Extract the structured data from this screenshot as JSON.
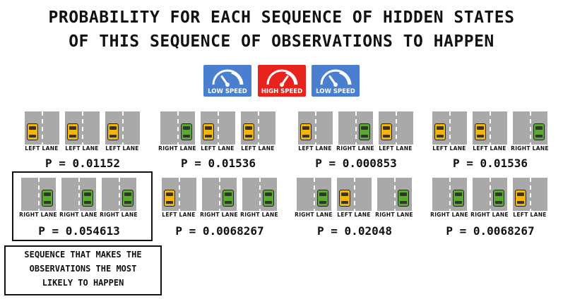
{
  "title": {
    "line1": "PROBABILITY FOR EACH SEQUENCE OF HIDDEN STATES",
    "line2": "OF THIS SEQUENCE OF OBSERVATIONS TO HAPPEN"
  },
  "observations": [
    {
      "label": "LOW SPEED",
      "color": "#4a7fd0",
      "icon": "speedometer-low-icon"
    },
    {
      "label": "HIGH SPEED",
      "color": "#e8231d",
      "icon": "speedometer-high-icon"
    },
    {
      "label": "LOW SPEED",
      "color": "#4a7fd0",
      "icon": "speedometer-low-icon"
    }
  ],
  "lane_labels": {
    "left": "LEFT LANE",
    "right": "RIGHT LANE"
  },
  "sequences": [
    {
      "states": [
        "left",
        "left",
        "left"
      ],
      "p": "P = 0.01152"
    },
    {
      "states": [
        "right",
        "left",
        "left"
      ],
      "p": "P = 0.01536"
    },
    {
      "states": [
        "left",
        "right",
        "left"
      ],
      "p": "P = 0.000853"
    },
    {
      "states": [
        "left",
        "left",
        "right"
      ],
      "p": "P = 0.01536"
    },
    {
      "states": [
        "right",
        "right",
        "right"
      ],
      "p": "P = 0.054613"
    },
    {
      "states": [
        "left",
        "right",
        "right"
      ],
      "p": "P = 0.0068267"
    },
    {
      "states": [
        "right",
        "left",
        "right"
      ],
      "p": "P = 0.02048"
    },
    {
      "states": [
        "right",
        "right",
        "left"
      ],
      "p": "P = 0.0068267"
    }
  ],
  "highlight_index": 4,
  "note": {
    "lines": [
      "SEQUENCE THAT MAKES THE",
      "OBSERVATIONS THE MOST",
      "LIKELY TO HAPPEN"
    ]
  }
}
